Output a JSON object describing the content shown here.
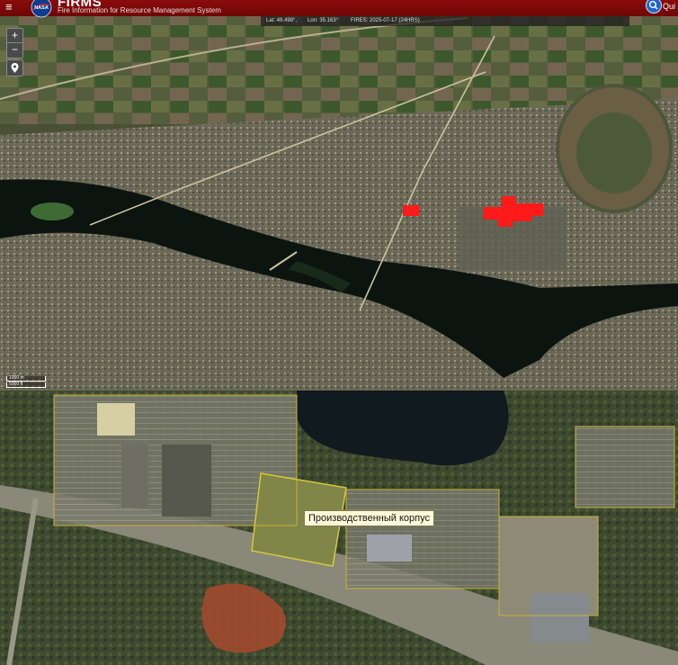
{
  "header": {
    "menu_glyph": "≡",
    "agency_logo_text": "NASA",
    "app_title": "FIRMS",
    "app_subtitle": "Fire Information for Resource Management System",
    "search_label": "Qui",
    "accent_color": "#7d0808"
  },
  "info_bar": {
    "lat": "Lat: 48.498°,",
    "lon": "Lon: 35.163°",
    "fires": "FIRES: 2025-07-17 (24HRS)"
  },
  "map_controls": {
    "zoom_in": "+",
    "zoom_out": "−",
    "locate_icon": "map-pin-icon"
  },
  "scale": {
    "metric": "1000 m",
    "imperial": "5000 ft"
  },
  "fire_color": "#ff1a1a",
  "fire_hotspots": [
    "small-hotspot-west",
    "large-hotspot-industrial"
  ],
  "detail_view": {
    "tooltip": "Производственный корпус"
  }
}
